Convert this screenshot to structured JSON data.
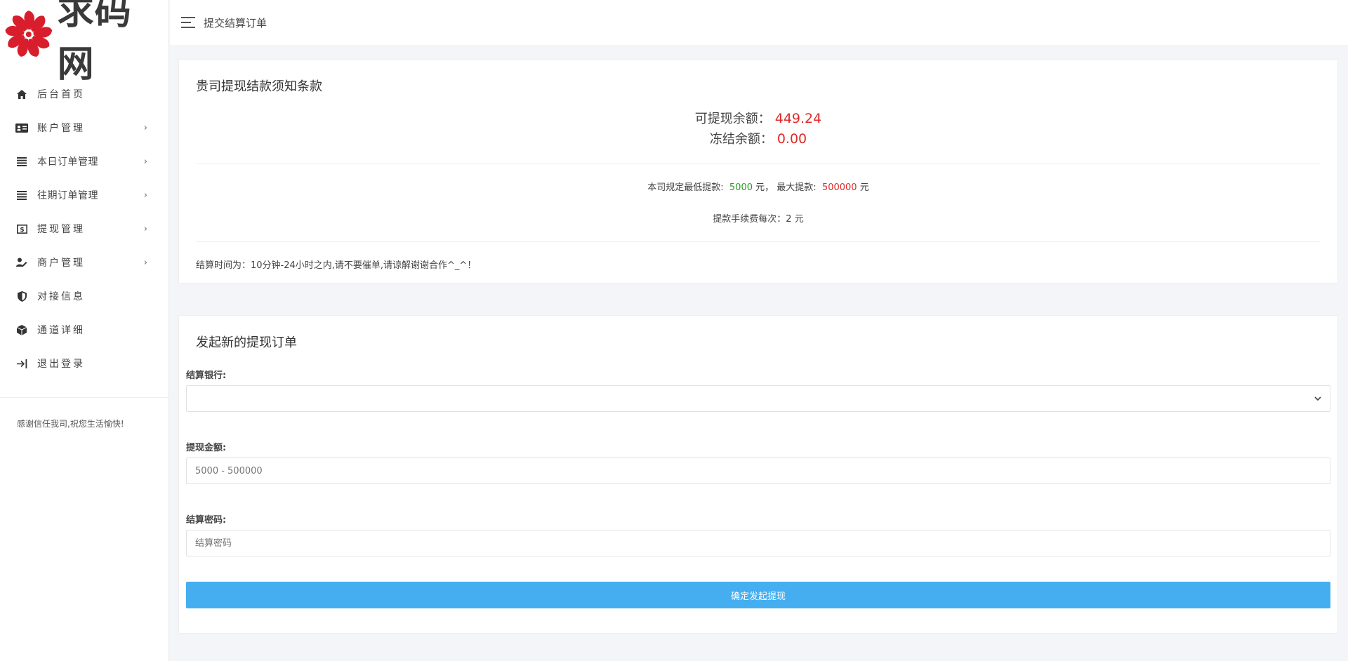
{
  "brand": {
    "name": "求码网"
  },
  "topbar": {
    "title": "提交结算订单"
  },
  "sidebar": {
    "items": [
      {
        "label": "后台首页",
        "icon": "home-icon",
        "has_submenu": false
      },
      {
        "label": "账户管理",
        "icon": "id-card-icon",
        "has_submenu": true
      },
      {
        "label": "本日订单管理",
        "icon": "list-icon",
        "has_submenu": true
      },
      {
        "label": "往期订单管理",
        "icon": "list-icon",
        "has_submenu": true
      },
      {
        "label": "提现管理",
        "icon": "dollar-icon",
        "has_submenu": true
      },
      {
        "label": "商户管理",
        "icon": "user-edit-icon",
        "has_submenu": true
      },
      {
        "label": "对接信息",
        "icon": "shield-icon",
        "has_submenu": false
      },
      {
        "label": "通道详细",
        "icon": "cube-icon",
        "has_submenu": false
      },
      {
        "label": "退出登录",
        "icon": "logout-icon",
        "has_submenu": false
      }
    ],
    "submenu_arrow": "›",
    "footer": "感谢信任我司,祝您生活愉快!"
  },
  "terms": {
    "title": "贵司提现结款须知条款",
    "available_label": "可提现余额：",
    "available_value": "449.24",
    "frozen_label": "冻结余额：",
    "frozen_value": "0.00",
    "min_label": "本司规定最低提款:",
    "min_value": "5000",
    "unit": "元",
    "max_label": "最大提款:",
    "max_value": "500000",
    "fee_text": "提款手续费每次：2 元",
    "settle_time": "结算时间为：10分钟-24小时之内,请不要催单,请谅解谢谢合作^_^！"
  },
  "form": {
    "title": "发起新的提现订单",
    "bank_label": "结算银行:",
    "bank_value": "",
    "amount_label": "提现金额:",
    "amount_placeholder": "5000 - 500000",
    "password_label": "结算密码:",
    "password_placeholder": "结算密码",
    "submit_label": "确定发起提现"
  },
  "colors": {
    "accent": "#45aef1",
    "red": "#e02828",
    "green": "#2b9a2b"
  }
}
